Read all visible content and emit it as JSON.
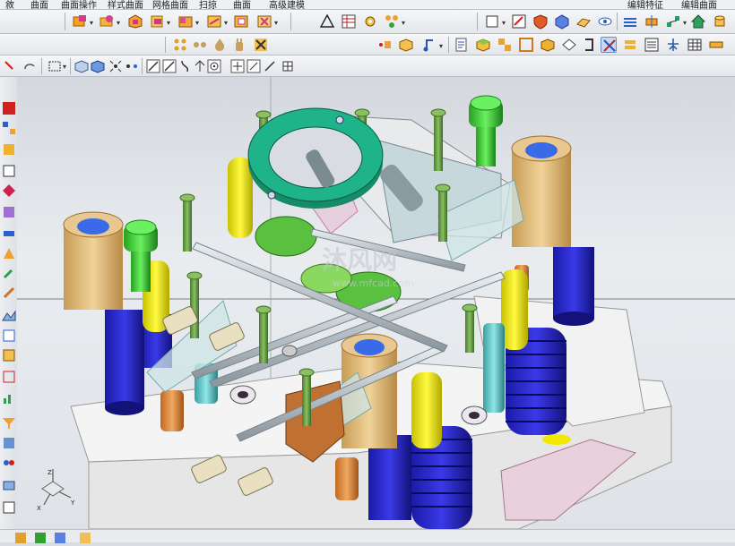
{
  "menubar": {
    "items": [
      "敘",
      "曲面",
      "曲面操作",
      "样式曲面",
      "网格曲面",
      "扫掠",
      "曲面",
      "高级建模",
      "编辑特征",
      "编辑曲面"
    ]
  },
  "toolbar": {
    "filter_select_value": "",
    "row3_icons": [
      "select-filter-icon",
      "box-select-icon",
      "view-shaded-icon",
      "view-wire-icon",
      "snap-endpoint-icon",
      "snap-midpoint-icon",
      "line-icon",
      "arc-icon",
      "curve-icon",
      "point-icon",
      "circle-center-icon",
      "crosshair-icon",
      "slash-icon",
      "grid-icon"
    ]
  },
  "viewport": {
    "watermark_name": "沐风网",
    "watermark_url": "www.mfcad.com"
  },
  "colors": {
    "toolbar_bg": "#eef0f3",
    "viewport_bg": "#e2e5e9",
    "mold_base": "#f2f2f2",
    "ring_green": "#1aa37c",
    "spring_blue": "#2424c8",
    "pillar_tan": "#d8b67a",
    "pin_yellow": "#f2e800",
    "bolt_green": "#3ad12a",
    "bolt_olive": "#6aa048",
    "rod_gray": "#b8c0c6",
    "transparent_block": "#c6dde0"
  }
}
